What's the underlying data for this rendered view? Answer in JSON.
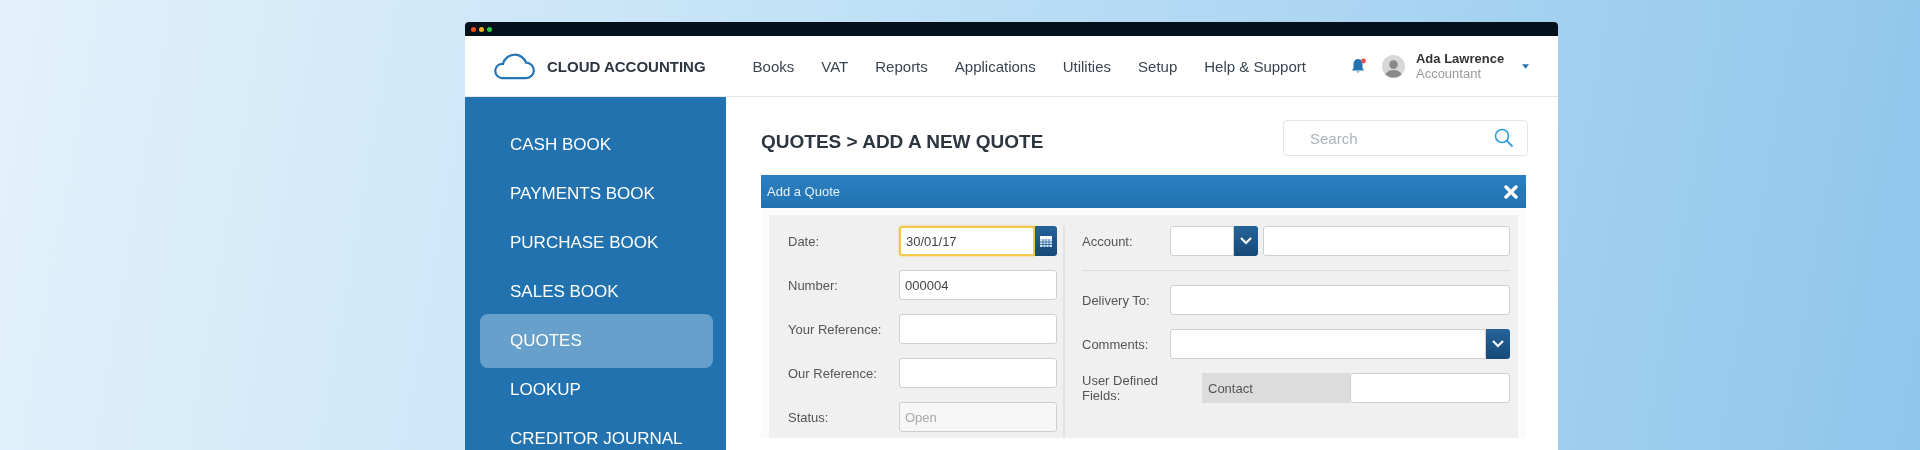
{
  "header": {
    "brand": "CLOUD ACCOUNTING",
    "nav": [
      "Books",
      "VAT",
      "Reports",
      "Applications",
      "Utilities",
      "Setup",
      "Help & Support"
    ],
    "notifications": {
      "unread": true
    },
    "user": {
      "name": "Ada Lawrence",
      "role": "Accountant"
    }
  },
  "sidebar": {
    "items": [
      {
        "label": "CASH BOOK",
        "selected": false
      },
      {
        "label": "PAYMENTS BOOK",
        "selected": false
      },
      {
        "label": "PURCHASE BOOK",
        "selected": false
      },
      {
        "label": "SALES BOOK",
        "selected": false
      },
      {
        "label": "QUOTES",
        "selected": true
      },
      {
        "label": "LOOKUP",
        "selected": false
      },
      {
        "label": "CREDITOR JOURNAL",
        "selected": false
      }
    ]
  },
  "page": {
    "title": "QUOTES > ADD A NEW QUOTE",
    "search": {
      "placeholder": "Search"
    }
  },
  "dialog": {
    "title": "Add a Quote",
    "left_fields": [
      {
        "label": "Date:",
        "kind": "date",
        "value": "30/01/17",
        "focused": true
      },
      {
        "label": "Number:",
        "kind": "text",
        "value": "000004",
        "focused": false
      },
      {
        "label": "Your Reference:",
        "kind": "text",
        "focused": false
      },
      {
        "label": "Our Reference:",
        "kind": "text",
        "focused": false
      },
      {
        "label": "Status:",
        "kind": "readonly",
        "value": "Open",
        "focused": false
      }
    ],
    "right_fields": [
      {
        "label": "Account:",
        "kind": "account"
      },
      {
        "label": "Delivery To:",
        "kind": "text"
      },
      {
        "label": "Comments:",
        "kind": "dropdown"
      },
      {
        "label": "User Defined Fields:",
        "kind": "udf",
        "field_name": "Contact"
      }
    ]
  }
}
